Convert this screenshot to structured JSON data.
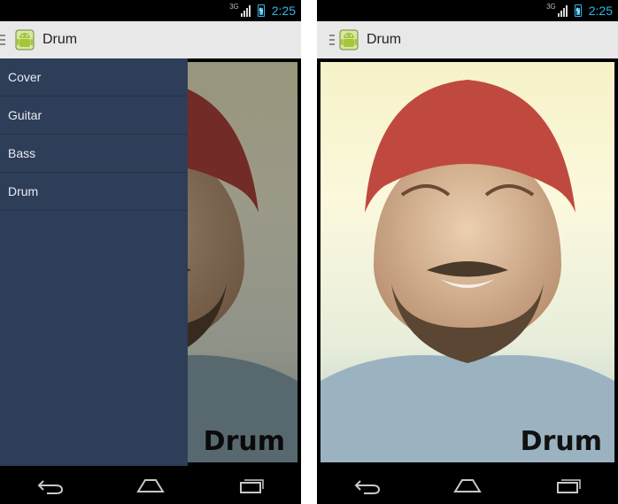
{
  "screens": {
    "left": {
      "status": {
        "network": "3G",
        "time": "2:25"
      },
      "action_bar": {
        "title": "Drum",
        "app_icon": "android-icon",
        "indicator": "drawer-indicator-icon"
      },
      "drawer": {
        "items": [
          {
            "label": "Cover"
          },
          {
            "label": "Guitar"
          },
          {
            "label": "Bass"
          },
          {
            "label": "Drum"
          }
        ]
      },
      "content": {
        "image_caption": "Drum"
      },
      "nav": {
        "back": "back-icon",
        "home": "home-icon",
        "recents": "recents-icon"
      }
    },
    "right": {
      "status": {
        "network": "3G",
        "time": "2:25"
      },
      "action_bar": {
        "title": "Drum",
        "app_icon": "android-icon",
        "indicator": "drawer-indicator-icon"
      },
      "content": {
        "image_caption": "Drum"
      },
      "nav": {
        "back": "back-icon",
        "home": "home-icon",
        "recents": "recents-icon"
      }
    }
  },
  "colors": {
    "drawer_bg": "#2e3d58",
    "action_bar_bg": "#e8e8e8",
    "status_accent": "#33b5e5"
  }
}
